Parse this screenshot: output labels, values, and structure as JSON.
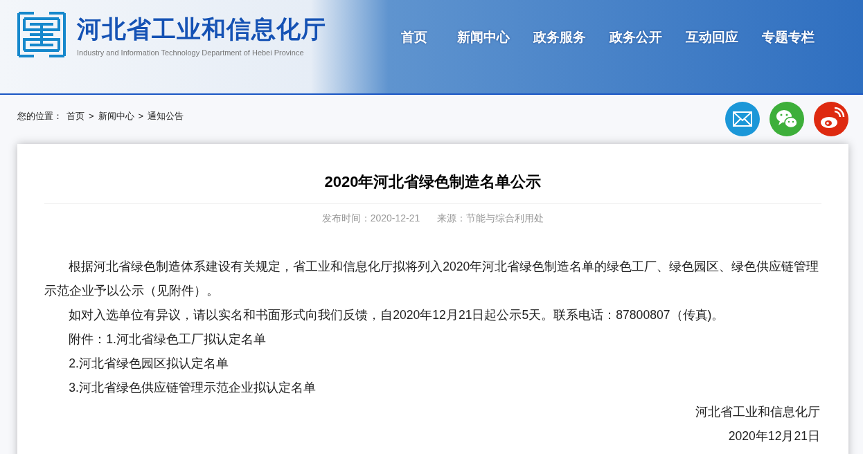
{
  "header": {
    "title": "河北省工业和信息化厅",
    "subtitle": "Industry and Information Technology Department of Hebei Province"
  },
  "nav": [
    {
      "label": "首页"
    },
    {
      "label": "新闻中心"
    },
    {
      "label": "政务服务"
    },
    {
      "label": "政务公开"
    },
    {
      "label": "互动回应"
    },
    {
      "label": "专题专栏"
    }
  ],
  "breadcrumb": {
    "label": "您的位置：",
    "items": [
      "首页",
      "新闻中心",
      "通知公告"
    ],
    "separators": [
      ">",
      ">"
    ]
  },
  "share": [
    {
      "kind": "mail"
    },
    {
      "kind": "wechat"
    },
    {
      "kind": "weibo"
    }
  ],
  "article": {
    "title": "2020年河北省绿色制造名单公示",
    "published": "发布时间：2020-12-21",
    "source": "来源：节能与综合利用处",
    "paragraphs": [
      {
        "kind": "body",
        "text": "根据河北省绿色制造体系建设有关规定，省工业和信息化厅拟将列入2020年河北省绿色制造名单的绿色工厂、绿色园区、绿色供应链管理示范企业予以公示（见附件）。"
      },
      {
        "kind": "body",
        "text": "如对入选单位有异议，请以实名和书面形式向我们反馈，自2020年12月21日起公示5天。联系电话：87800807（传真)。"
      },
      {
        "kind": "body",
        "text": "附件：1.河北省绿色工厂拟认定名单"
      },
      {
        "kind": "body",
        "text": "2.河北省绿色园区拟认定名单"
      },
      {
        "kind": "body",
        "text": "3.河北省绿色供应链管理示范企业拟认定名单"
      },
      {
        "kind": "signature",
        "text": "河北省工业和信息化厅"
      },
      {
        "kind": "signature",
        "text": "2020年12月21日"
      }
    ]
  }
}
